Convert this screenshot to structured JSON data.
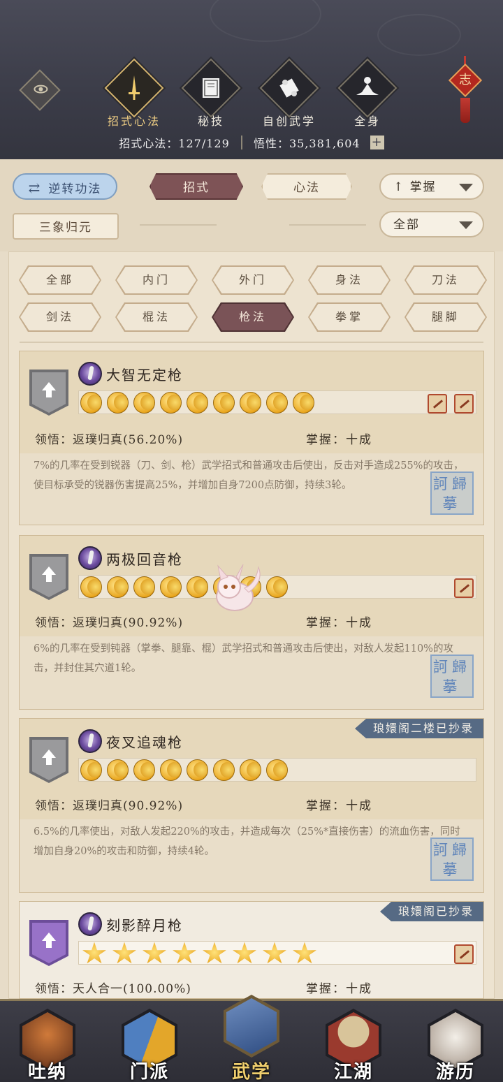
{
  "header": {
    "tabs": [
      {
        "label": "招式心法",
        "icon": "sword-icon",
        "active": true
      },
      {
        "label": "秘技",
        "icon": "book-icon",
        "active": false
      },
      {
        "label": "自创武学",
        "icon": "scroll-icon",
        "active": false
      },
      {
        "label": "全身",
        "icon": "meditation-icon",
        "active": false
      }
    ],
    "knot_char": "志",
    "stats": {
      "moves_label": "招式心法：127/129",
      "insight_label": "悟性：35,381,604"
    }
  },
  "filters": {
    "reverse_button": "逆转功法",
    "type_tabs": [
      {
        "label": "招式",
        "active": true
      },
      {
        "label": "心法",
        "active": false
      }
    ],
    "sort_dropdown": "掌握",
    "scope_dropdown": "全部",
    "sanxiang_button": "三象归元"
  },
  "categories": [
    {
      "label": "全部",
      "selected": false
    },
    {
      "label": "内门",
      "selected": false
    },
    {
      "label": "外门",
      "selected": false
    },
    {
      "label": "身法",
      "selected": false
    },
    {
      "label": "刀法",
      "selected": false
    },
    {
      "label": "剑法",
      "selected": false
    },
    {
      "label": "棍法",
      "selected": false
    },
    {
      "label": "枪法",
      "selected": true
    },
    {
      "label": "拳掌",
      "selected": false
    },
    {
      "label": "腿脚",
      "selected": false
    }
  ],
  "skills": [
    {
      "name": "大智无定枪",
      "level_icons": 9,
      "level_type": "moon",
      "insight": "领悟：返璞归真(56.20%)",
      "mastery": "掌握：十成",
      "description": "7%的几率在受到锐器（刀、剑、枪）武学招式和普通攻击后使出，反击对手造成255%的攻击，使目标承受的锐器伤害提高25%，并增加自身7200点防御，持续3轮。",
      "ribbon": "",
      "seal": "訶歸摹",
      "seal_text": "訶歸摹"
    },
    {
      "name": "两极回音枪",
      "level_icons": 8,
      "level_type": "moon",
      "insight": "领悟：返璞归真(90.92%)",
      "mastery": "掌握：十成",
      "description": "6%的几率在受到钝器（掌拳、腿靠、棍）武学招式和普通攻击后使出，对敌人发起110%的攻击，并封住其穴道1轮。",
      "ribbon": "",
      "seal_text": "訶歸摹"
    },
    {
      "name": "夜叉追魂枪",
      "level_icons": 8,
      "level_type": "moon",
      "insight": "领悟：返璞归真(90.92%)",
      "mastery": "掌握：十成",
      "description": "6.5%的几率使出，对敌人发起220%的攻击，并造成每次（25%*直接伤害）的流血伤害，同时增加自身20%的攻击和防御，持续4轮。",
      "ribbon": "琅嬛阁二楼已抄录",
      "seal_text": "訶歸摹"
    },
    {
      "name": "刻影醉月枪",
      "level_icons": 8,
      "level_type": "star",
      "insight": "领悟：天人合一(100.00%)",
      "mastery": "掌握：十成",
      "description": "",
      "ribbon": "琅嬛阁已抄录"
    }
  ],
  "bottom_nav": [
    {
      "label": "吐纳",
      "active": false,
      "color": "#b85a2a"
    },
    {
      "label": "门派",
      "active": false,
      "color": "#4f7fc0"
    },
    {
      "label": "武学",
      "active": true,
      "color": "#4d6fa8"
    },
    {
      "label": "江湖",
      "active": false,
      "color": "#b0463a"
    },
    {
      "label": "游历",
      "active": false,
      "color": "#d8d3cc"
    }
  ]
}
